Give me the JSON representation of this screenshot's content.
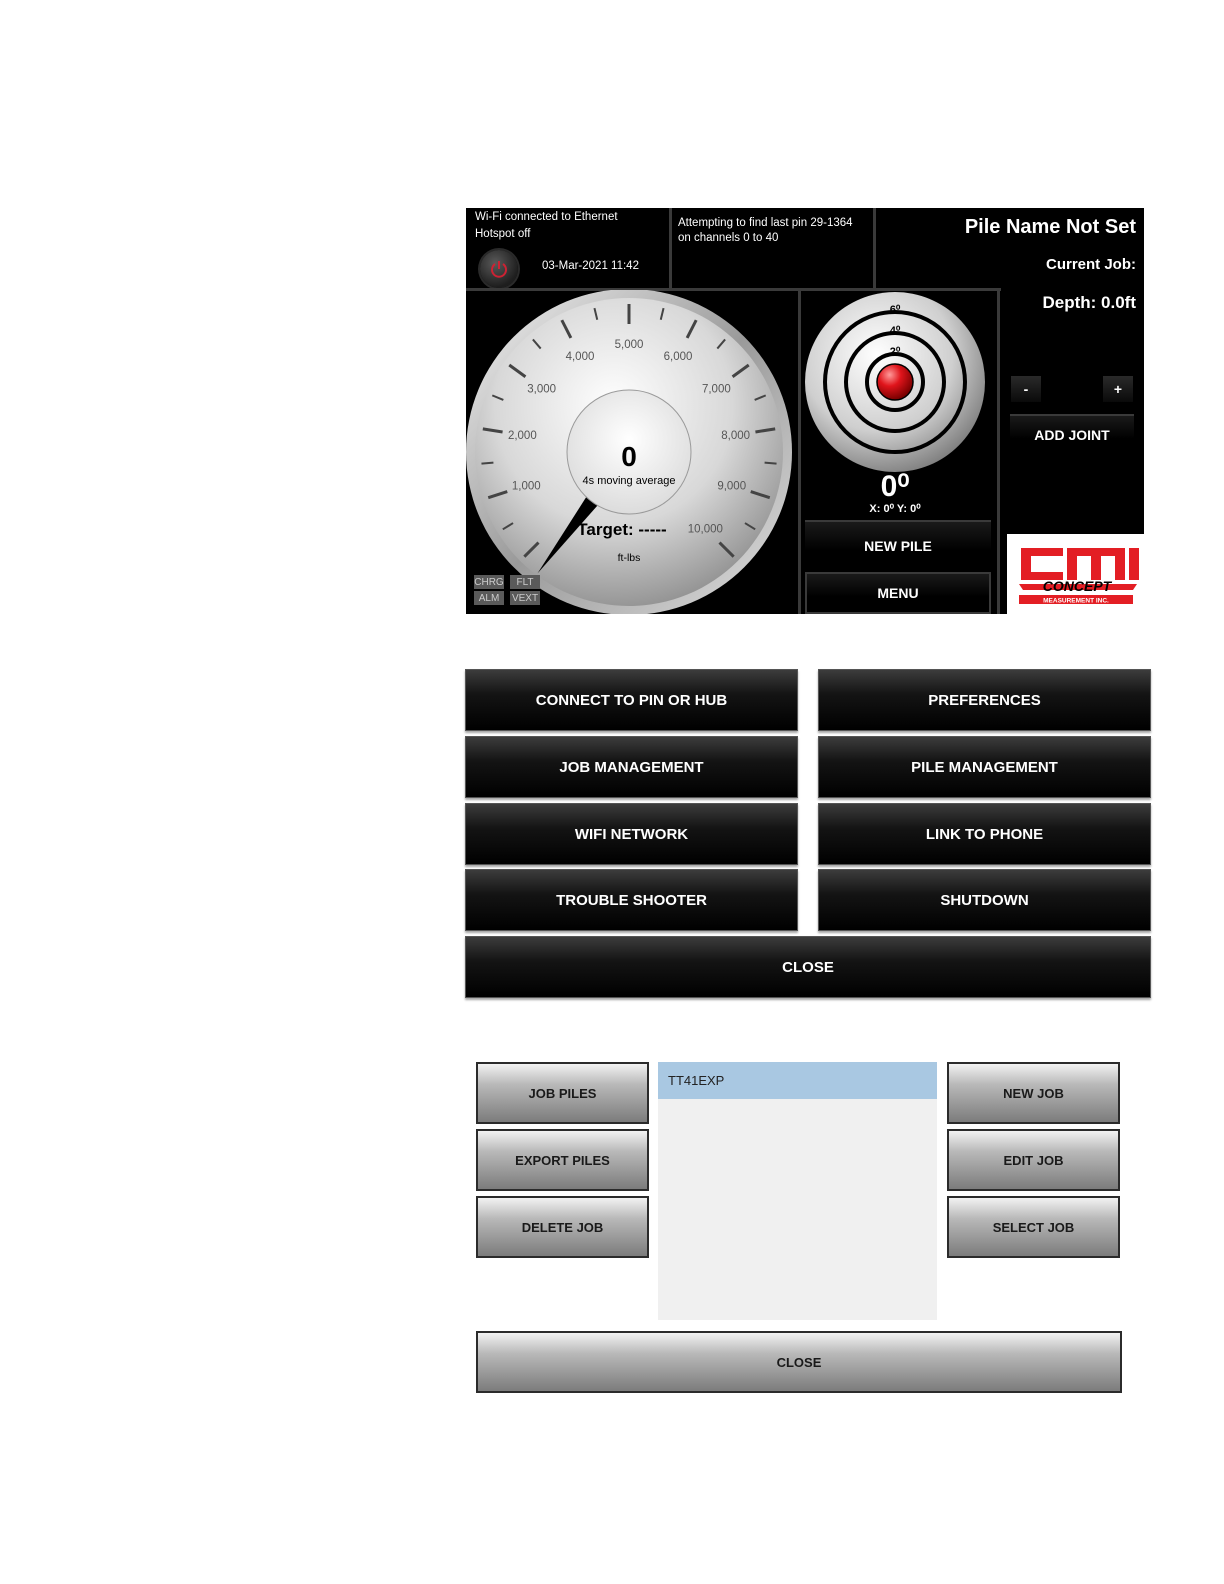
{
  "status": {
    "wifi_line1": "Wi-Fi connected to Ethernet",
    "wifi_line2": "Hotspot off",
    "datetime": "03-Mar-2021 11:42",
    "search_line1": "Attempting to find last pin 29-1364",
    "search_line2": "on channels 0 to 40"
  },
  "pile": {
    "name": "Pile Name Not Set",
    "current_job": "Current Job:",
    "depth": "Depth: 0.0ft"
  },
  "gauge": {
    "value": "0",
    "subtitle": "4s moving average",
    "target": "Target: -----",
    "unit": "ft-lbs",
    "tick_labels": [
      "1,000",
      "2,000",
      "3,000",
      "4,000",
      "5,000",
      "6,000",
      "7,000",
      "8,000",
      "9,000",
      "10,000"
    ],
    "current_value": 0
  },
  "indicators": {
    "chrg": "CHRG",
    "flt": "FLT",
    "alm": "ALM",
    "vext": "VEXT"
  },
  "level": {
    "rings": [
      "6⁰",
      "4⁰",
      "2⁰"
    ],
    "angle": "0⁰",
    "xy": "X: 0⁰ Y: 0⁰"
  },
  "controls": {
    "minus": "-",
    "plus": "+",
    "add_joint": "ADD JOINT",
    "new_pile": "NEW PILE",
    "menu": "MENU"
  },
  "logo": {
    "main": "CMI",
    "line1": "CONCEPT",
    "line2": "MEASUREMENT INC."
  },
  "menu": {
    "connect": "CONNECT TO PIN OR HUB",
    "preferences": "PREFERENCES",
    "job_management": "JOB MANAGEMENT",
    "pile_management": "PILE MANAGEMENT",
    "wifi": "WIFI NETWORK",
    "link_phone": "LINK TO PHONE",
    "trouble": "TROUBLE SHOOTER",
    "shutdown": "SHUTDOWN",
    "close": "CLOSE"
  },
  "jobs": {
    "job_piles": "JOB PILES",
    "export_piles": "EXPORT PILES",
    "delete_job": "DELETE JOB",
    "new_job": "NEW JOB",
    "edit_job": "EDIT JOB",
    "select_job": "SELECT JOB",
    "list": [
      "TT41EXP"
    ],
    "close": "CLOSE"
  },
  "colors": {
    "accent_red": "#e31e24",
    "selection_blue": "#a9c8e2"
  }
}
